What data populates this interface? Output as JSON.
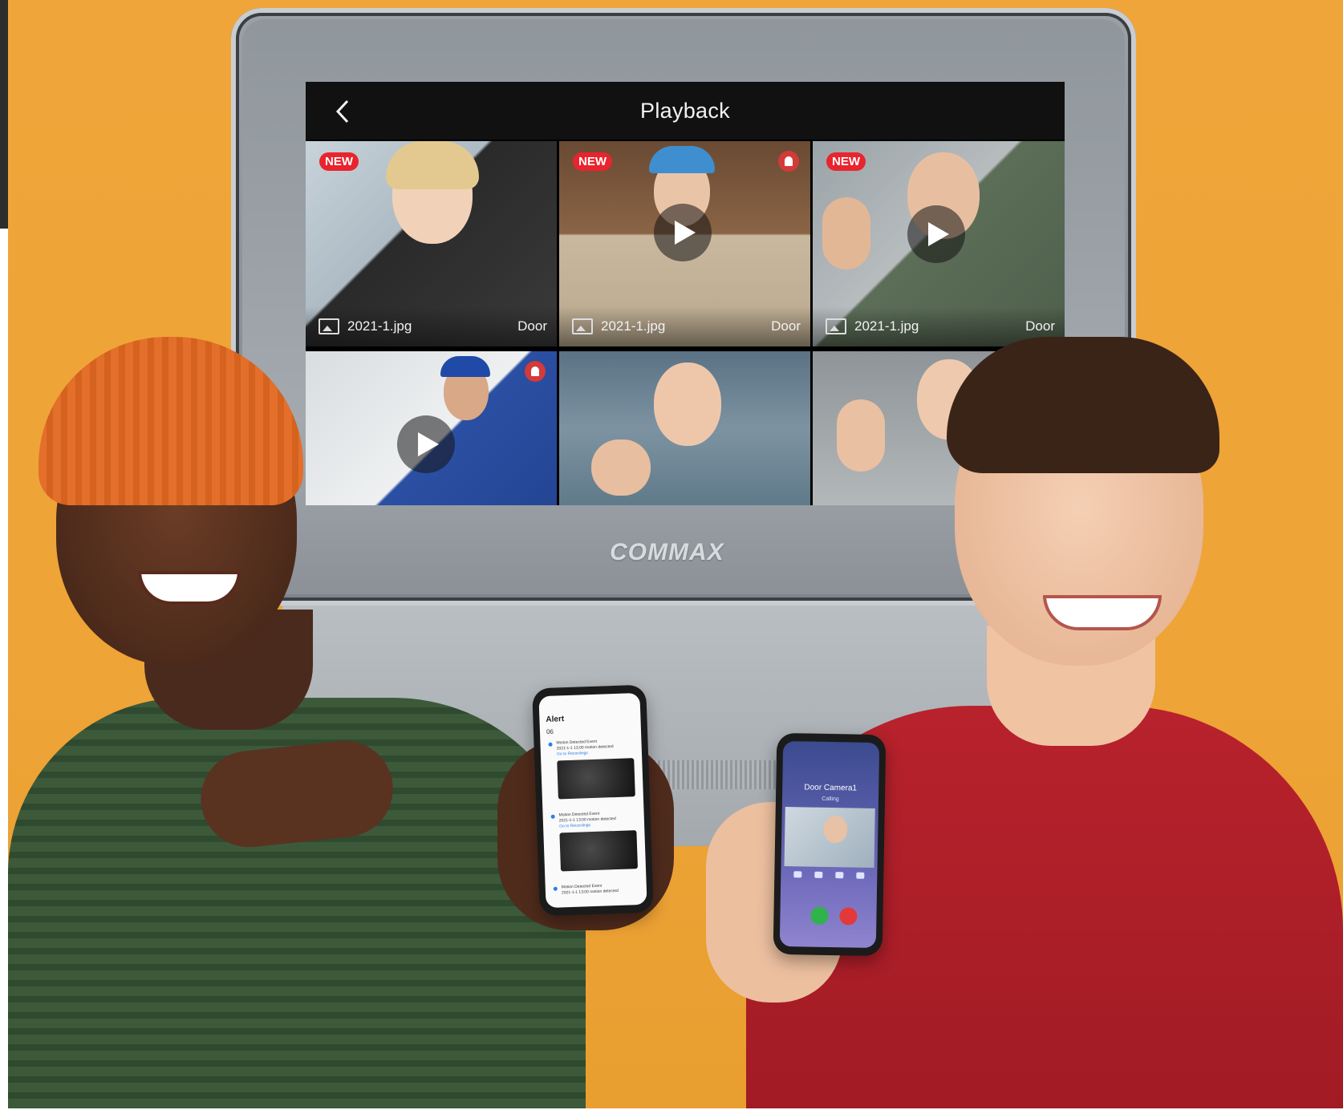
{
  "screen": {
    "title": "Playback",
    "tiles": [
      {
        "badge": "NEW",
        "file": "2021-1.jpg",
        "source": "Door",
        "play": false,
        "alarm": false
      },
      {
        "badge": "NEW",
        "file": "2021-1.jpg",
        "source": "Door",
        "play": true,
        "alarm": true
      },
      {
        "badge": "NEW",
        "file": "2021-1.jpg",
        "source": "Door",
        "play": true,
        "alarm": false
      },
      {
        "badge": "",
        "file": "",
        "source": "",
        "play": true,
        "alarm": true
      },
      {
        "badge": "",
        "file": "",
        "source": "",
        "play": false,
        "alarm": false
      },
      {
        "badge": "",
        "file": "",
        "source": "",
        "play": false,
        "alarm": false
      }
    ]
  },
  "brand": "COMMAX",
  "phone_alert": {
    "title": "Alert",
    "date": "06",
    "items": [
      {
        "line1": "Motion Detected Event",
        "line2": "2021-1-1 13:00 motion detected",
        "line3": "Go to Recordings"
      },
      {
        "line1": "Motion Detected Event",
        "line2": "2021-1-1 13:00 motion detected",
        "line3": "Go to Recordings"
      },
      {
        "line1": "Motion Detected Event",
        "line2": "2021-1-1 13:00 motion detected",
        "line3": ""
      }
    ]
  },
  "phone_call": {
    "name": "Door Camera1",
    "status": "Calling"
  },
  "colors": {
    "background": "#f0a53a",
    "badge": "#e8242e",
    "accept": "#2fb34a",
    "decline": "#e23a3a"
  }
}
